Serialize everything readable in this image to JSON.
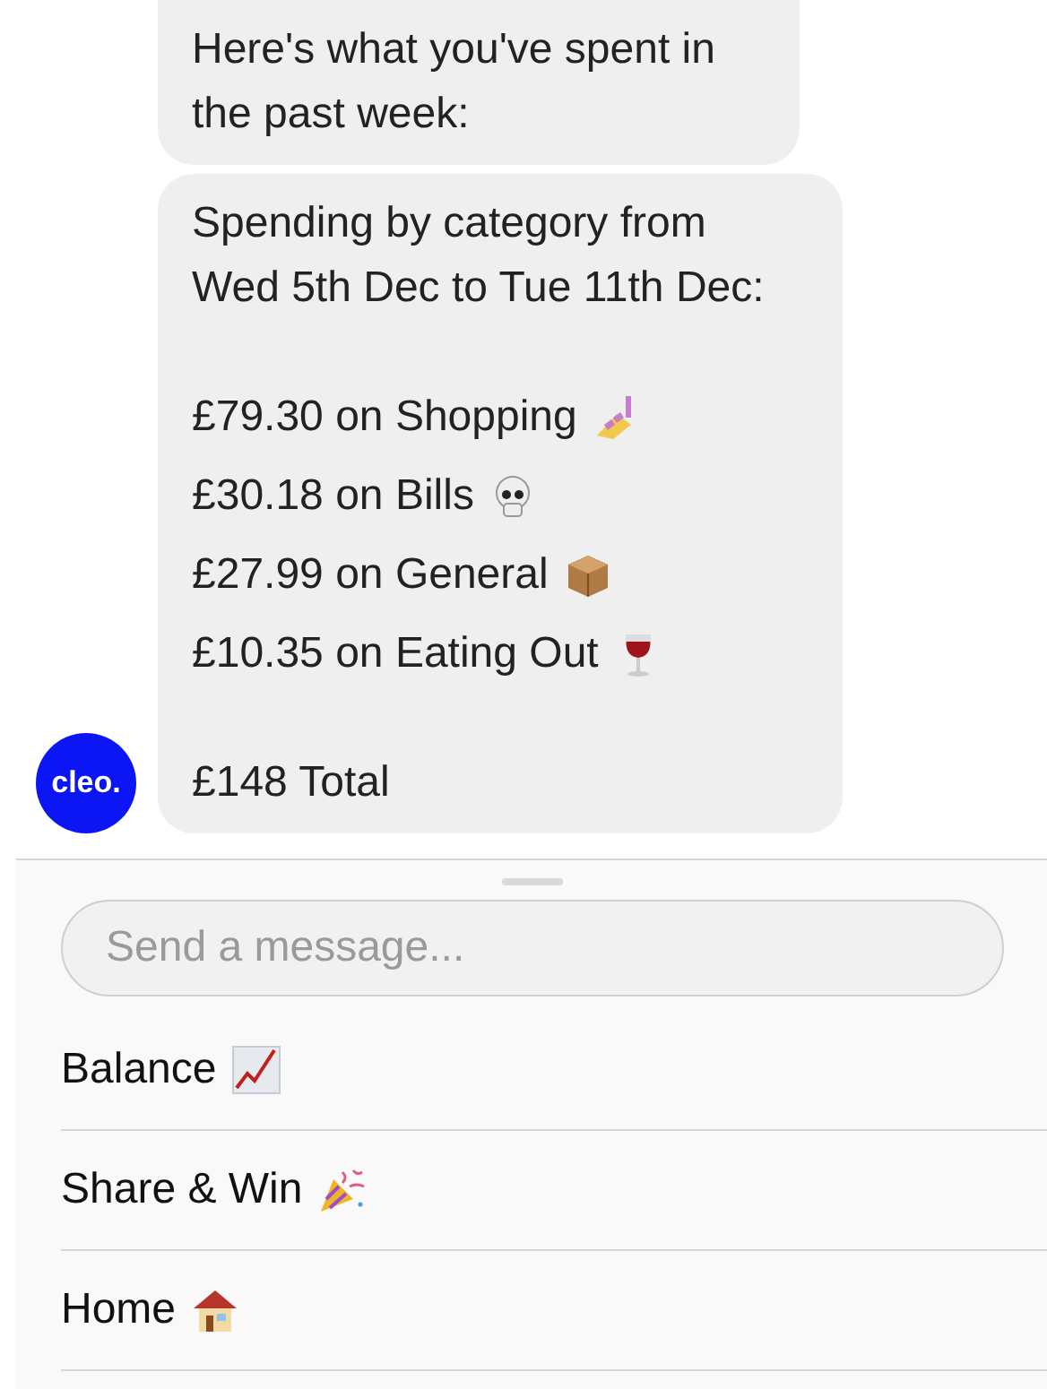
{
  "messages": [
    {
      "kind": "text",
      "text": "Here's what you've spent in the past week:"
    },
    {
      "kind": "summary",
      "heading": "Spending by category from Wed 5th Dec to Tue 11th Dec:",
      "items": [
        {
          "text": "£79.30 on Shopping",
          "kind": "nail-polish"
        },
        {
          "text": "£30.18 on Bills",
          "kind": "skull"
        },
        {
          "text": "£27.99 on General",
          "kind": "box"
        },
        {
          "text": "£10.35 on Eating Out",
          "kind": "wine"
        }
      ],
      "total": "£148 Total"
    }
  ],
  "avatar": {
    "label": "cleo."
  },
  "composer": {
    "placeholder": "Send a message..."
  },
  "quick_replies": [
    {
      "label": "Balance",
      "kind": "chart"
    },
    {
      "label": "Share & Win",
      "kind": "party"
    },
    {
      "label": "Home",
      "kind": "house"
    }
  ]
}
